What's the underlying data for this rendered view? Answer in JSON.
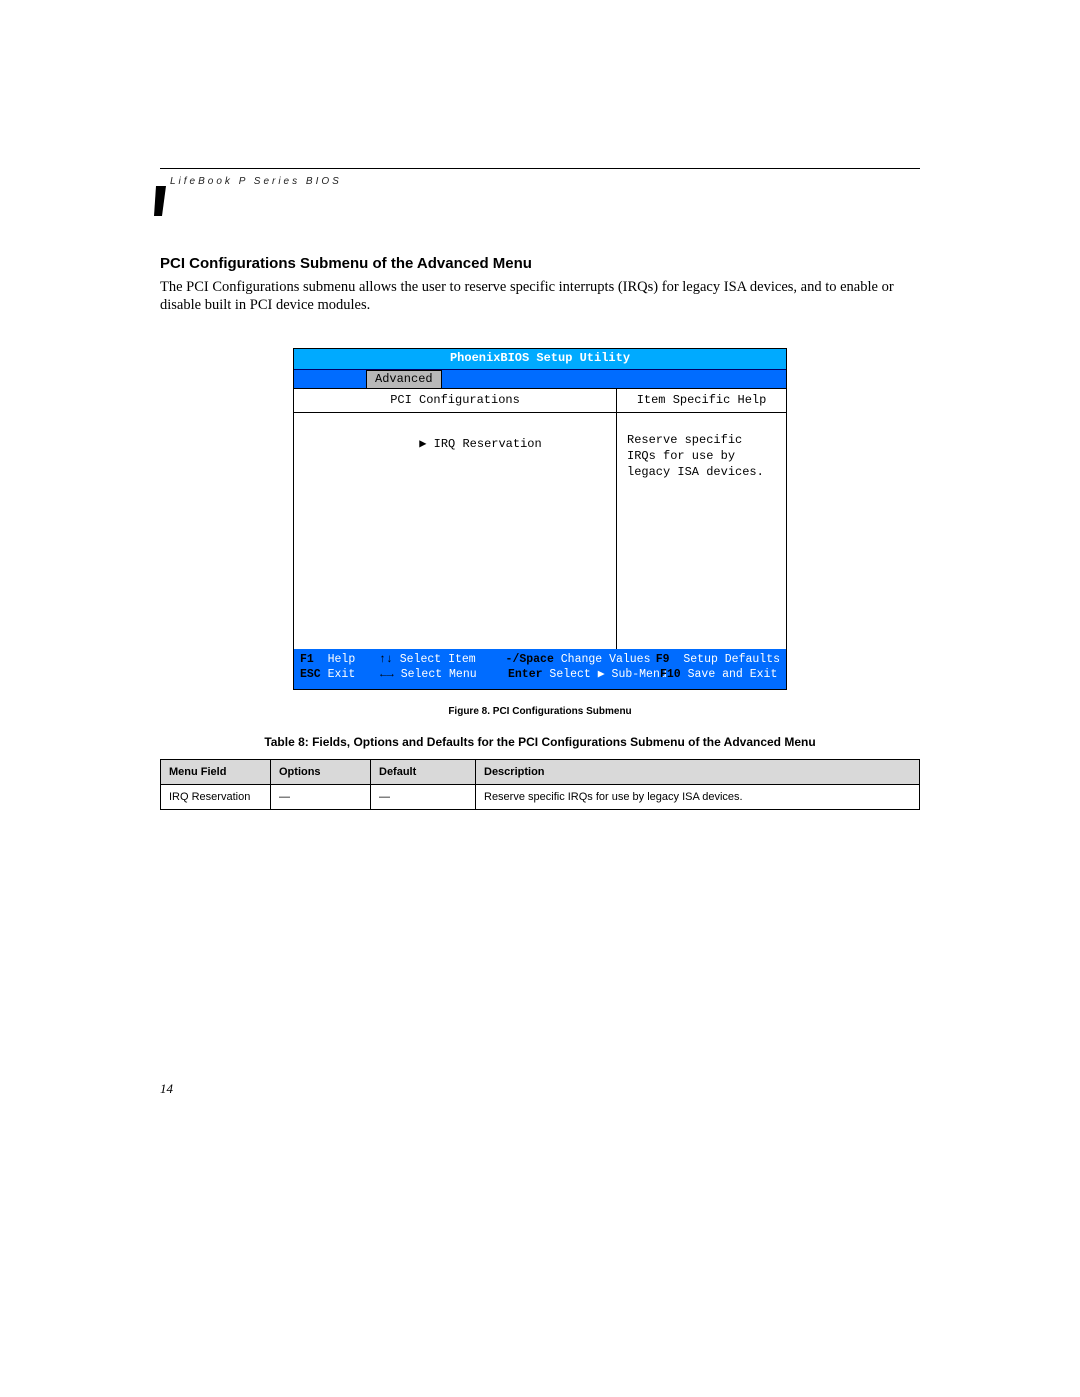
{
  "running_head": "LifeBook P Series BIOS",
  "section_heading": "PCI Configurations Submenu of the Advanced Menu",
  "body_text": "The PCI Configurations submenu allows the user to reserve specific interrupts (IRQs) for legacy ISA devices, and to enable or disable built in PCI device modules.",
  "bios": {
    "title": "PhoenixBIOS Setup Utility",
    "active_tab": "Advanced",
    "left_header": "PCI Configurations",
    "right_header": "Item Specific Help",
    "menu_item": "IRQ Reservation",
    "help_text": "Reserve specific IRQs for use by legacy ISA devices.",
    "footer": {
      "r1c1_key": "F1",
      "r1c1_lbl": "Help",
      "r1c2_key": "↑↓",
      "r1c2_lbl": "Select Item",
      "r1c3_key": "-/Space",
      "r1c3_lbl": "Change Values",
      "r1c4_key": "F9",
      "r1c4_lbl": "Setup Defaults",
      "r2c1_key": "ESC",
      "r2c1_lbl": "Exit",
      "r2c2_key": "←→",
      "r2c2_lbl": "Select Menu",
      "r2c3_key": "Enter",
      "r2c3_lbl": "Select ▶ Sub-Menu",
      "r2c4_key": "F10",
      "r2c4_lbl": "Save and Exit"
    }
  },
  "figure_caption": "Figure 8.  PCI Configurations Submenu",
  "table_caption": "Table 8: Fields, Options and Defaults for the PCI Configurations Submenu of the Advanced Menu",
  "table": {
    "headers": {
      "c1": "Menu Field",
      "c2": "Options",
      "c3": "Default",
      "c4": "Description"
    },
    "row": {
      "c1": "IRQ Reservation",
      "c2": "—",
      "c3": "—",
      "c4": "Reserve specific IRQs for use by legacy ISA devices."
    }
  },
  "page_number": "14"
}
